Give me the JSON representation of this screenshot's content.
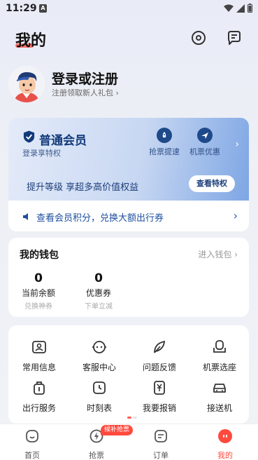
{
  "status_bar": {
    "time": "11:29",
    "app_letter": "A"
  },
  "header": {
    "title": "我的"
  },
  "profile": {
    "title": "登录或注册",
    "subtitle": "注册领取新人礼包 ›"
  },
  "member": {
    "name": "普通会员",
    "subtitle": "登录享特权",
    "perks": [
      {
        "label": "抢票提速",
        "icon": "rocket-icon"
      },
      {
        "label": "机票优惠",
        "icon": "plane-icon"
      }
    ],
    "upgrade_text": "提升等级 享超多高价值权益",
    "upgrade_button": "查看特权",
    "points_text": "查看会员积分，兑换大额出行券",
    "colors": {
      "accent": "#123a7a",
      "gradient_end": "#7ea6e4"
    }
  },
  "wallet": {
    "title": "我的钱包",
    "link": "进入钱包 ›",
    "items": [
      {
        "value": "0",
        "label": "当前余额",
        "hint": "兑换神券"
      },
      {
        "value": "0",
        "label": "优惠券",
        "hint": "下单立减"
      }
    ]
  },
  "services": [
    {
      "label": "常用信息",
      "icon": "id-card-icon"
    },
    {
      "label": "客服中心",
      "icon": "support-icon"
    },
    {
      "label": "问题反馈",
      "icon": "feather-icon"
    },
    {
      "label": "机票选座",
      "icon": "seat-icon"
    },
    {
      "label": "出行服务",
      "icon": "luggage-icon"
    },
    {
      "label": "时刻表",
      "icon": "clock-icon"
    },
    {
      "label": "我要报销",
      "icon": "invoice-icon"
    },
    {
      "label": "接送机",
      "icon": "car-icon"
    }
  ],
  "tabs": [
    {
      "label": "首页",
      "icon": "home-icon",
      "active": false
    },
    {
      "label": "抢票",
      "icon": "bolt-icon",
      "active": false,
      "badge": "候补抢票"
    },
    {
      "label": "订单",
      "icon": "order-icon",
      "active": false
    },
    {
      "label": "我的",
      "icon": "profile-icon",
      "active": true
    }
  ],
  "accent_color": "#ff4a3d"
}
